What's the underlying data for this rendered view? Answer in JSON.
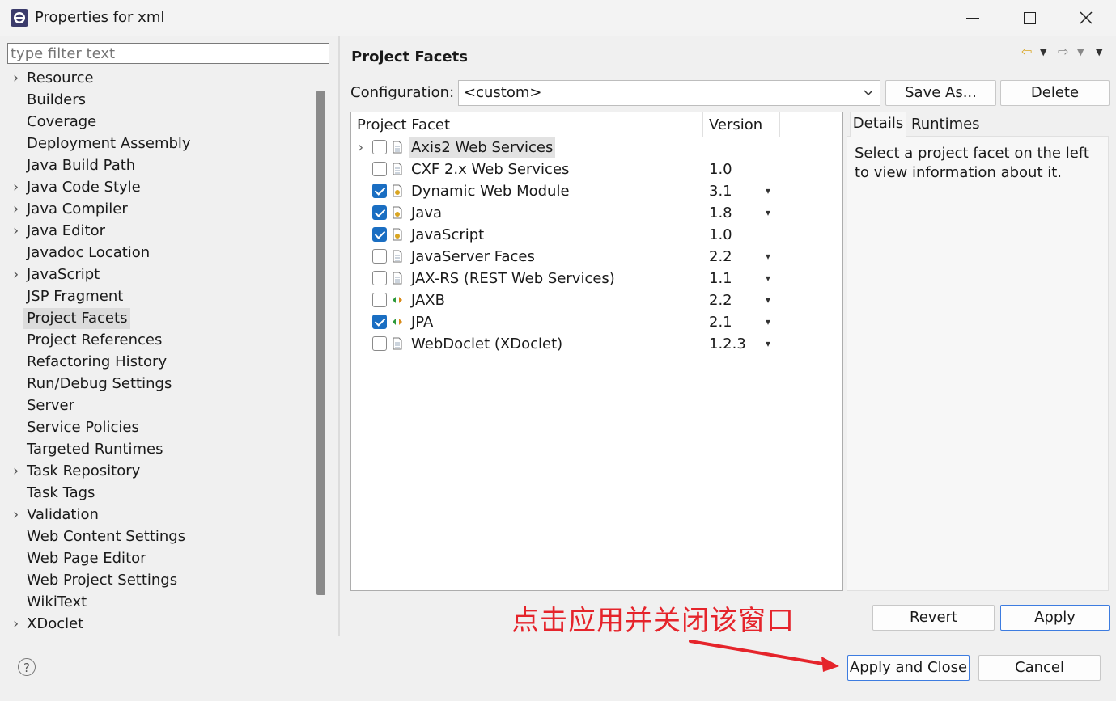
{
  "window": {
    "title": "Properties for xml",
    "controls": [
      "minimize",
      "maximize",
      "close"
    ]
  },
  "filter": {
    "placeholder": "type filter text",
    "value": ""
  },
  "nav": {
    "items": [
      {
        "label": "Resource",
        "expandable": true
      },
      {
        "label": "Builders",
        "expandable": false
      },
      {
        "label": "Coverage",
        "expandable": false
      },
      {
        "label": "Deployment Assembly",
        "expandable": false
      },
      {
        "label": "Java Build Path",
        "expandable": false
      },
      {
        "label": "Java Code Style",
        "expandable": true
      },
      {
        "label": "Java Compiler",
        "expandable": true
      },
      {
        "label": "Java Editor",
        "expandable": true
      },
      {
        "label": "Javadoc Location",
        "expandable": false
      },
      {
        "label": "JavaScript",
        "expandable": true
      },
      {
        "label": "JSP Fragment",
        "expandable": false
      },
      {
        "label": "Project Facets",
        "expandable": false,
        "selected": true
      },
      {
        "label": "Project References",
        "expandable": false
      },
      {
        "label": "Refactoring History",
        "expandable": false
      },
      {
        "label": "Run/Debug Settings",
        "expandable": false
      },
      {
        "label": "Server",
        "expandable": false
      },
      {
        "label": "Service Policies",
        "expandable": false
      },
      {
        "label": "Targeted Runtimes",
        "expandable": false
      },
      {
        "label": "Task Repository",
        "expandable": true
      },
      {
        "label": "Task Tags",
        "expandable": false
      },
      {
        "label": "Validation",
        "expandable": true
      },
      {
        "label": "Web Content Settings",
        "expandable": false
      },
      {
        "label": "Web Page Editor",
        "expandable": false
      },
      {
        "label": "Web Project Settings",
        "expandable": false
      },
      {
        "label": "WikiText",
        "expandable": false
      },
      {
        "label": "XDoclet",
        "expandable": true
      }
    ]
  },
  "page": {
    "title": "Project Facets",
    "configuration_label": "Configuration:",
    "configuration_value": "<custom>",
    "save_as_label": "Save As...",
    "delete_label": "Delete"
  },
  "facets": {
    "col_facet": "Project Facet",
    "col_version": "Version",
    "rows": [
      {
        "name": "Axis2 Web Services",
        "version": "",
        "checked": false,
        "dropdown": false,
        "expandable": true,
        "icon": "page-icon",
        "highlight": true
      },
      {
        "name": "CXF 2.x Web Services",
        "version": "1.0",
        "checked": false,
        "dropdown": false,
        "icon": "page-icon"
      },
      {
        "name": "Dynamic Web Module",
        "version": "3.1",
        "checked": true,
        "dropdown": true,
        "icon": "gear-page-icon"
      },
      {
        "name": "Java",
        "version": "1.8",
        "checked": true,
        "dropdown": true,
        "icon": "gear-page-icon"
      },
      {
        "name": "JavaScript",
        "version": "1.0",
        "checked": true,
        "dropdown": false,
        "icon": "gear-page-icon"
      },
      {
        "name": "JavaServer Faces",
        "version": "2.2",
        "checked": false,
        "dropdown": true,
        "icon": "page-icon"
      },
      {
        "name": "JAX-RS (REST Web Services)",
        "version": "1.1",
        "checked": false,
        "dropdown": true,
        "icon": "page-icon"
      },
      {
        "name": "JAXB",
        "version": "2.2",
        "checked": false,
        "dropdown": true,
        "icon": "arrows-icon"
      },
      {
        "name": "JPA",
        "version": "2.1",
        "checked": true,
        "dropdown": true,
        "icon": "arrows-icon"
      },
      {
        "name": "WebDoclet (XDoclet)",
        "version": "1.2.3",
        "checked": false,
        "dropdown": true,
        "icon": "page-icon"
      }
    ]
  },
  "details": {
    "tab_details": "Details",
    "tab_runtimes": "Runtimes",
    "text": "Select a project facet on the left to view information about it."
  },
  "buttons": {
    "revert": "Revert",
    "apply": "Apply",
    "apply_close": "Apply and Close",
    "cancel": "Cancel"
  },
  "annotation": {
    "text": "点击应用并关闭该窗口",
    "color": "#e5242b"
  },
  "help": {
    "glyph": "?"
  },
  "colors": {
    "accent": "#1a6ec2",
    "primary_border": "#3d7ce0"
  }
}
